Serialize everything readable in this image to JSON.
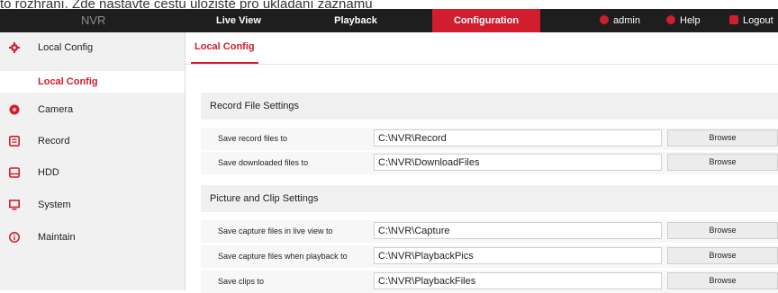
{
  "caption_text": "to rozhraní. Zde nastavte cestu úložiště pro ukládání záznamů",
  "topbar": {
    "brand": "NVR",
    "tabs": [
      "Live View",
      "Playback",
      "Configuration"
    ],
    "active_tab": "Configuration",
    "user": "admin",
    "help": "Help",
    "logout": "Logout"
  },
  "sidebar": {
    "items": [
      {
        "label": "Local Config",
        "icon": "gear-icon"
      },
      {
        "label": "Camera",
        "icon": "camera-icon"
      },
      {
        "label": "Record",
        "icon": "record-icon"
      },
      {
        "label": "HDD",
        "icon": "hdd-icon"
      },
      {
        "label": "System",
        "icon": "monitor-icon"
      },
      {
        "label": "Maintain",
        "icon": "info-icon"
      }
    ],
    "sub_active": "Local Config"
  },
  "main": {
    "tab": "Local Config",
    "sections": [
      {
        "title": "Record File Settings",
        "rows": [
          {
            "label": "Save record files to",
            "value": "C:\\NVR\\Record",
            "button": "Browse"
          },
          {
            "label": "Save downloaded files to",
            "value": "C:\\NVR\\DownloadFiles",
            "button": "Browse"
          }
        ]
      },
      {
        "title": "Picture and Clip Settings",
        "rows": [
          {
            "label": "Save capture files in live view to",
            "value": "C:\\NVR\\Capture",
            "button": "Browse"
          },
          {
            "label": "Save capture files when playback to",
            "value": "C:\\NVR\\PlaybackPics",
            "button": "Browse"
          },
          {
            "label": "Save clips to",
            "value": "C:\\NVR\\PlaybackFiles",
            "button": "Browse"
          }
        ]
      }
    ]
  },
  "colors": {
    "accent": "#d11d2d",
    "topbar": "#1e1e1e",
    "sidebar": "#f1f1f1"
  }
}
